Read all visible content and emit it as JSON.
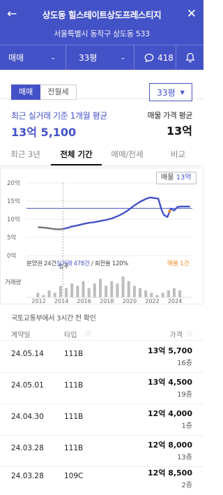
{
  "header": {
    "title": "상도동 힐스테이트상도프레스티지",
    "address": "서울특별시 동작구 상도동 533",
    "filter_deal": "매매",
    "filter_size": "33평",
    "comment_count": "418"
  },
  "toggle": {
    "sale": "매매",
    "rent": "전월세"
  },
  "size_select": "33평",
  "summary": {
    "avg_label": "최근 실거래 기준 1개월 평균",
    "avg_value": "13억 5,100",
    "ask_label": "매물 가격 평균",
    "ask_value": "13억"
  },
  "tabs": [
    "최근 3년",
    "전체 기간",
    "매매/전세",
    "비교"
  ],
  "active_tab": 1,
  "chart_data": {
    "type": "line",
    "y_ticks": [
      "20억",
      "15억",
      "10억",
      "5억",
      "0억"
    ],
    "x_ticks": [
      "2012",
      "2014",
      "2016",
      "2018",
      "2020",
      "2022",
      "2024"
    ],
    "ylim": [
      0,
      20
    ],
    "listing_line": 13,
    "tooltip_label": "매물",
    "tooltip_value": "13억",
    "move_in_label": "입주",
    "series": [
      {
        "name": "분양권",
        "color": "#777777",
        "x": [
          2012.0,
          2012.5,
          2013.0,
          2013.4,
          2013.8,
          2014.2
        ],
        "y": [
          7.8,
          7.7,
          7.5,
          7.3,
          7.2,
          7.3
        ]
      },
      {
        "name": "실거래",
        "color": "#4452c7",
        "x": [
          2014.2,
          2014.6,
          2015.0,
          2015.5,
          2016.0,
          2016.5,
          2017.0,
          2017.5,
          2018.0,
          2018.5,
          2019.0,
          2019.5,
          2020.0,
          2020.5,
          2021.0,
          2021.5,
          2021.9,
          2022.3,
          2022.6,
          2022.9,
          2023.1,
          2023.4,
          2023.7,
          2024.0,
          2024.3,
          2024.6,
          2025.0,
          2025.4
        ],
        "y": [
          7.3,
          7.6,
          8.0,
          8.3,
          8.7,
          9.0,
          9.2,
          9.5,
          9.8,
          10.2,
          10.8,
          11.6,
          12.6,
          13.8,
          14.8,
          15.6,
          16.0,
          15.8,
          15.7,
          12.5,
          11.2,
          10.6,
          12.9,
          12.4,
          13.4,
          13.5,
          13.5,
          13.5
        ]
      }
    ],
    "volume": {
      "x": [
        2012.0,
        2012.5,
        2013.0,
        2013.5,
        2014.0,
        2014.5,
        2015.0,
        2015.5,
        2016.0,
        2016.5,
        2017.0,
        2017.5,
        2018.0,
        2018.5,
        2019.0,
        2019.5,
        2020.0,
        2020.5,
        2021.0,
        2021.5,
        2022.0,
        2022.5,
        2023.0,
        2023.5,
        2024.0,
        2024.5
      ],
      "values": [
        2,
        1,
        3,
        2,
        5,
        4,
        6,
        5,
        7,
        4,
        6,
        8,
        5,
        7,
        6,
        9,
        7,
        5,
        4,
        3,
        2,
        1,
        2,
        3,
        4,
        3
      ]
    },
    "note": {
      "presale": "분양권 24건",
      "trades": "실거래 478건",
      "turnover": "/ 회전율 120%",
      "listing": "매물 1건"
    },
    "volume_label": "거래량"
  },
  "update_text": "국토교통부에서 3시간 전 확인",
  "table": {
    "headers": {
      "date": "계약일",
      "type": "타입",
      "price": "가격"
    },
    "rows": [
      {
        "date": "24.05.14",
        "type": "111B",
        "price": "13억 5,700",
        "floor": "16층"
      },
      {
        "date": "24.05.01",
        "type": "111B",
        "price": "13억 4,500",
        "floor": "19층"
      },
      {
        "date": "24.04.30",
        "type": "111B",
        "price": "12억 4,000",
        "floor": "1층"
      },
      {
        "date": "24.03.28",
        "type": "111B",
        "price": "12억 8,000",
        "floor": "13층"
      },
      {
        "date": "24.03.28",
        "type": "109C",
        "price": "12억 8,500",
        "floor": "2층"
      }
    ]
  },
  "colors": {
    "brand": "#4452c7",
    "presale": "#777777",
    "listing": "#f08a24"
  }
}
